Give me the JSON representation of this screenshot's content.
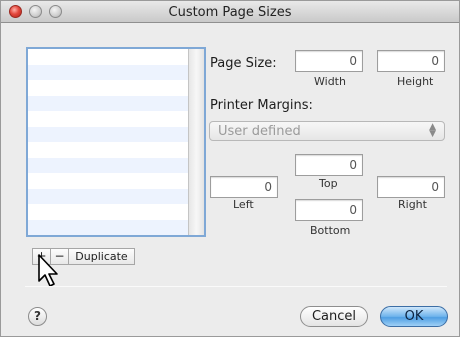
{
  "window": {
    "title": "Custom Page Sizes"
  },
  "list": {
    "rows": 12
  },
  "page_size": {
    "label": "Page Size:",
    "width_value": "0",
    "width_label": "Width",
    "height_value": "0",
    "height_label": "Height"
  },
  "margins": {
    "label": "Printer Margins:",
    "popup_value": "User defined",
    "top_value": "0",
    "top_label": "Top",
    "left_value": "0",
    "left_label": "Left",
    "right_value": "0",
    "right_label": "Right",
    "bottom_value": "0",
    "bottom_label": "Bottom"
  },
  "list_controls": {
    "add_label": "+",
    "remove_label": "−",
    "duplicate_label": "Duplicate"
  },
  "footer": {
    "help_label": "?",
    "cancel_label": "Cancel",
    "ok_label": "OK"
  },
  "colors": {
    "accent": "#4e9ee3",
    "list_focus": "#7fa8d6",
    "close_red": "#e3483d"
  },
  "icons": {
    "close": "close-icon",
    "minimize": "minimize-icon",
    "zoom": "zoom-icon",
    "popup_arrows": "updown-arrows-icon",
    "cursor": "mouse-pointer-icon",
    "help": "help-icon"
  }
}
